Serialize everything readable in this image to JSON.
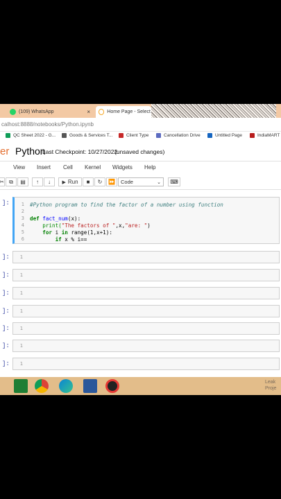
{
  "browser": {
    "tabs": [
      {
        "label": "(109) WhatsApp",
        "close": "×"
      },
      {
        "label": "Home Page - Select or"
      }
    ],
    "address": "calhost:8888/notebooks/Python.ipynb",
    "bookmarks": [
      "QC Sheet 2022 - G...",
      "Goods & Services T...",
      "Client Type",
      "Cancellation Drive",
      "Untitled Page",
      "IndiaMART"
    ]
  },
  "jupyter": {
    "logo_fragment": "er",
    "notebook_name": "Python",
    "checkpoint": "Last Checkpoint: 10/27/2022",
    "unsaved": "(unsaved changes)",
    "menu": [
      "View",
      "Insert",
      "Cell",
      "Kernel",
      "Widgets",
      "Help"
    ],
    "toolbar": {
      "run_label": "Run",
      "cell_type": "Code"
    }
  },
  "cells": {
    "prompt": "]:",
    "code_cell": {
      "lines": [
        "1",
        "2",
        "3",
        "4",
        "5",
        "6"
      ]
    },
    "empty_cells": [
      {
        "prompt": "]:",
        "line": "1"
      },
      {
        "prompt": "]:",
        "line": "1"
      },
      {
        "prompt": "]:",
        "line": "1"
      },
      {
        "prompt": "]:",
        "line": "1"
      },
      {
        "prompt": "]:",
        "line": "1"
      },
      {
        "prompt": "]:",
        "line": "1"
      },
      {
        "prompt": "]:",
        "line": "1"
      }
    ]
  },
  "code": {
    "l1": "#Python program to find the factor of a number using function",
    "l3_kw": "def",
    "l3_fn": "fact_num",
    "l3_rest": "(x):",
    "l4_a": "    print(",
    "l4_str1": "\"The factors of \"",
    "l4_mid": ",x,",
    "l4_str2": "\"are: \"",
    "l4_end": ")",
    "l5_kw": "    for",
    "l5_mid": " i ",
    "l5_in": "in",
    "l5_rest": " range(1,x+1):",
    "l6_kw": "        if",
    "l6_rest": " x % i=="
  },
  "taskbar": {
    "right_text_1": "Leak",
    "right_text_2": "Proje"
  }
}
